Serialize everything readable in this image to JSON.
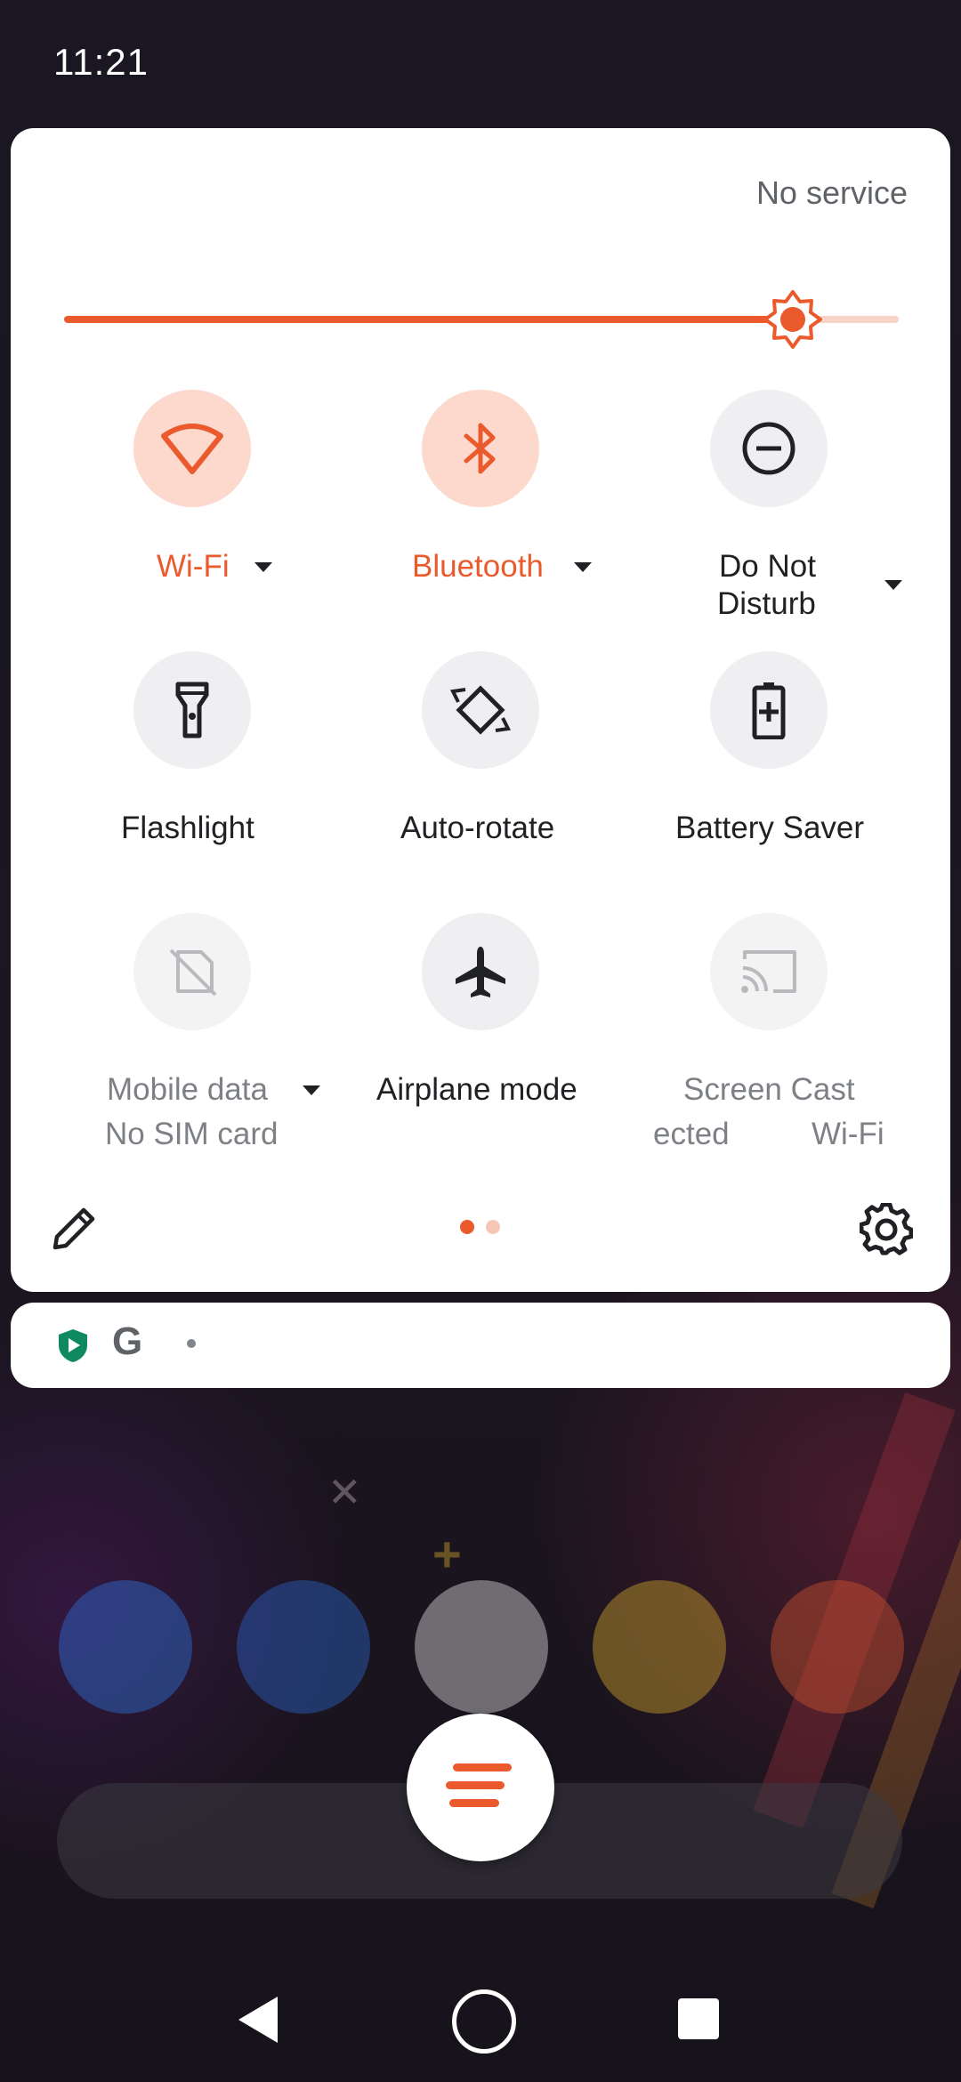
{
  "status_bar": {
    "time": "11:21"
  },
  "quick_settings": {
    "carrier": "No service",
    "brightness": {
      "level_fraction": 0.87
    },
    "tiles": [
      {
        "id": "wifi",
        "label": "Wi-Fi",
        "icon": "wifi-icon",
        "state": "on",
        "has_dropdown": true
      },
      {
        "id": "bluetooth",
        "label": "Bluetooth",
        "icon": "bluetooth-icon",
        "state": "on",
        "has_dropdown": true
      },
      {
        "id": "dnd",
        "label_line1": "Do Not",
        "label_line2": "Disturb",
        "icon": "do-not-disturb-icon",
        "state": "off",
        "has_dropdown": true
      },
      {
        "id": "flashlight",
        "label": "Flashlight",
        "icon": "flashlight-icon",
        "state": "off"
      },
      {
        "id": "auto_rotate",
        "label": "Auto-rotate",
        "icon": "auto-rotate-icon",
        "state": "off"
      },
      {
        "id": "battery_saver",
        "label": "Battery Saver",
        "icon": "battery-saver-icon",
        "state": "off"
      },
      {
        "id": "mobile_data",
        "label": "Mobile data",
        "sublabel": "No SIM card",
        "icon": "mobile-data-off-icon",
        "state": "unavailable",
        "has_dropdown": true
      },
      {
        "id": "airplane",
        "label": "Airplane mode",
        "icon": "airplane-icon",
        "state": "off"
      },
      {
        "id": "screen_cast",
        "label": "Screen Cast",
        "sublabel_left": "ected",
        "sublabel_right": "Wi-Fi",
        "icon": "cast-icon",
        "state": "unavailable"
      }
    ],
    "pages": {
      "count": 2,
      "current": 1
    }
  },
  "colors": {
    "accent": "#ea5a2c",
    "tile_on_bg": "#fcd9cc",
    "tile_off_bg": "#efeff1"
  }
}
